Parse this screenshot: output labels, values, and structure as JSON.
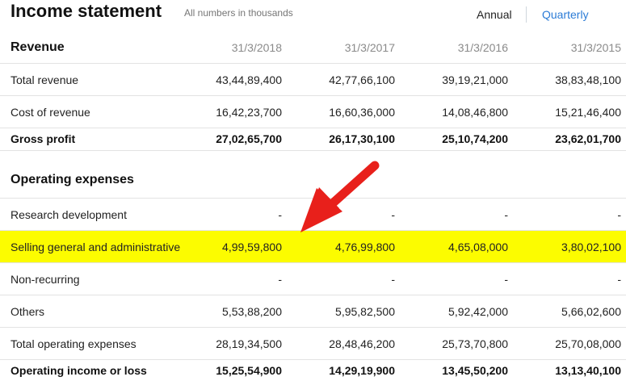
{
  "header": {
    "title": "Income statement",
    "subtitle": "All numbers in thousands",
    "annual_label": "Annual",
    "quarterly_label": "Quarterly"
  },
  "columns": [
    "31/3/2018",
    "31/3/2017",
    "31/3/2016",
    "31/3/2015"
  ],
  "revenue_section": {
    "title": "Revenue",
    "rows": [
      {
        "label": "Total revenue",
        "values": [
          "43,44,89,400",
          "42,77,66,100",
          "39,19,21,000",
          "38,83,48,100"
        ]
      },
      {
        "label": "Cost of revenue",
        "values": [
          "16,42,23,700",
          "16,60,36,000",
          "14,08,46,800",
          "15,21,46,400"
        ]
      },
      {
        "label": "Gross profit",
        "values": [
          "27,02,65,700",
          "26,17,30,100",
          "25,10,74,200",
          "23,62,01,700"
        ]
      }
    ]
  },
  "operating_section": {
    "title": "Operating expenses",
    "rows": [
      {
        "label": "Research development",
        "values": [
          "-",
          "-",
          "-",
          "-"
        ]
      },
      {
        "label": "Selling general and administrative",
        "values": [
          "4,99,59,800",
          "4,76,99,800",
          "4,65,08,000",
          "3,80,02,100"
        ]
      },
      {
        "label": "Non-recurring",
        "values": [
          "-",
          "-",
          "-",
          "-"
        ]
      },
      {
        "label": "Others",
        "values": [
          "5,53,88,200",
          "5,95,82,500",
          "5,92,42,000",
          "5,66,02,600"
        ]
      },
      {
        "label": "Total operating expenses",
        "values": [
          "28,19,34,500",
          "28,48,46,200",
          "25,73,70,800",
          "25,70,08,000"
        ]
      },
      {
        "label": "Operating income or loss",
        "values": [
          "15,25,54,900",
          "14,29,19,900",
          "13,45,50,200",
          "13,13,40,100"
        ]
      }
    ]
  },
  "colors": {
    "highlight": "#fcfc00",
    "arrow": "#e8201b",
    "link": "#2b7bd6"
  }
}
